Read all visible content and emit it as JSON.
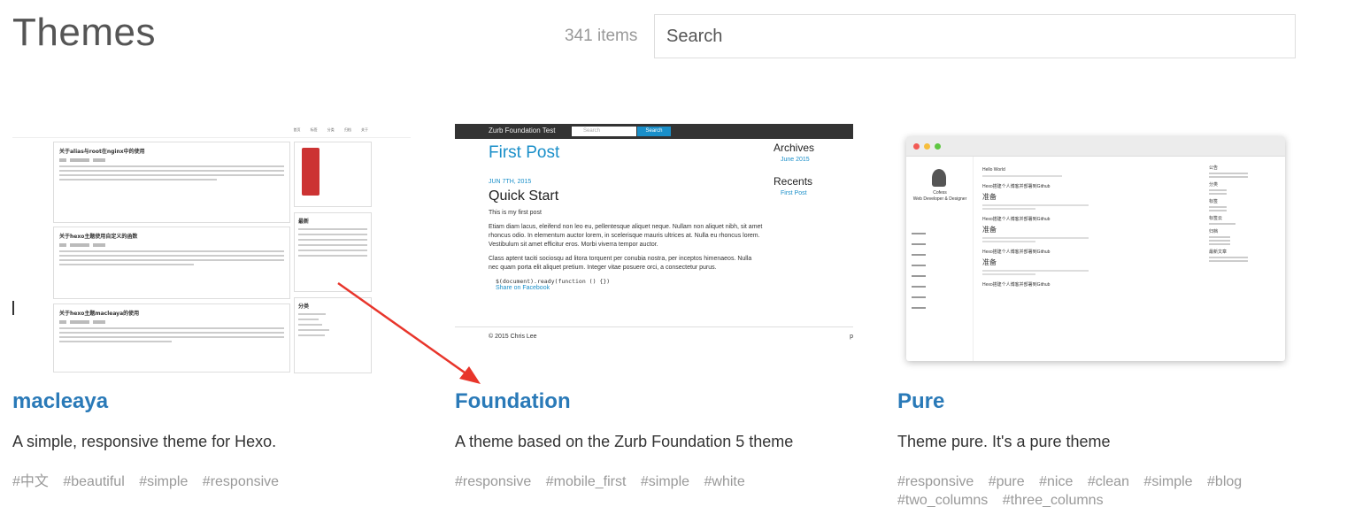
{
  "header": {
    "title": "Themes",
    "count": "341 items",
    "search_placeholder": "Search"
  },
  "cards": [
    {
      "title": "macleaya",
      "description": "A simple, responsive theme for Hexo.",
      "tags": [
        "#中文",
        "#beautiful",
        "#simple",
        "#responsive"
      ],
      "thumb": {
        "nav": "首页 标签 分类 归档 关于",
        "posts": [
          "关于alias与root在nginx中的使用",
          "关于hexo主题使用自定义的函数",
          "关于hexo主题macleaya的使用"
        ],
        "side_headings": [
          "最新",
          "分类"
        ]
      }
    },
    {
      "title": "Foundation",
      "description": "A theme based on the Zurb Foundation 5 theme",
      "tags": [
        "#responsive",
        "#mobile_first",
        "#simple",
        "#white"
      ],
      "thumb": {
        "brand": "Zurb Foundation Test",
        "search_placeholder": "Search",
        "search_button": "Search",
        "post_title": "First Post",
        "date": "JUN 7TH, 2015",
        "subtitle": "Quick Start",
        "intro": "This is my first post",
        "para1": "Etiam diam lacus, eleifend non leo eu, pellentesque aliquet neque. Nullam non aliquet nibh, sit amet rhoncus odio. In elementum auctor lorem, in scelerisque mauris ultrices at. Nulla eu rhoncus lorem. Vestibulum sit amet efficitur eros. Morbi viverra tempor auctor.",
        "para2": "Class aptent taciti sociosqu ad litora torquent per conubia nostra, per inceptos himenaeos. Nulla nec quam porta elit aliquet pretium. Integer vitae posuere orci, a consectetur purus.",
        "code": "$(document).ready(function () {})",
        "share": "Share on Facebook",
        "footer": "© 2015 Chris Lee",
        "footer_right": "p",
        "archives_heading": "Archives",
        "archives_item": "June 2015",
        "recents_heading": "Recents",
        "recents_item": "First Post"
      }
    },
    {
      "title": "Pure",
      "description": "Theme pure. It's a pure theme",
      "tags": [
        "#responsive",
        "#pure",
        "#nice",
        "#clean",
        "#simple",
        "#blog",
        "#two_columns",
        "#three_columns"
      ],
      "thumb": {
        "name": "Cofess",
        "role": "Web Developer & Designer",
        "post_heading": "Hello World",
        "post_items": [
          "Hexo搭建个人博客并部署到Github",
          "Hexo搭建个人博客并部署到Github",
          "Hexo搭建个人博客并部署到Github",
          "Hexo搭建个人博客并部署到Github"
        ],
        "big": "准备",
        "right_headings": [
          "公告",
          "分类",
          "标签",
          "标签云",
          "归档",
          "最新文章"
        ]
      }
    }
  ],
  "colors": {
    "link": "#2a7ab8",
    "muted": "#999999",
    "arrow": "#e8352b"
  }
}
